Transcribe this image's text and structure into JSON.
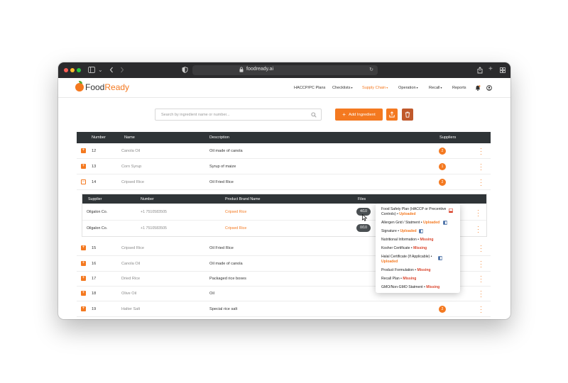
{
  "browser": {
    "url": "foodready.ai"
  },
  "app": {
    "logo_food": "Food",
    "logo_ready": "Ready"
  },
  "nav": [
    {
      "label": "HACCP/PC Plans",
      "caret": false,
      "active": false
    },
    {
      "label": "Checklists",
      "caret": true,
      "active": false
    },
    {
      "label": "Supply Chain",
      "caret": true,
      "active": true
    },
    {
      "label": "Operation",
      "caret": true,
      "active": false
    },
    {
      "label": "Recall",
      "caret": true,
      "active": false
    },
    {
      "label": "Reports",
      "caret": false,
      "active": false
    }
  ],
  "toolbar": {
    "search_placeholder": "Search by ingredient name or number...",
    "add_label": "Add Ingredient"
  },
  "table": {
    "headers": {
      "number": "Number",
      "name": "Name",
      "description": "Description",
      "suppliers": "Suppliers"
    },
    "rows_top": [
      {
        "num": "12",
        "name": "Canola Oil",
        "desc": "Oil made of canola",
        "suppliers": "2",
        "expanded": false
      },
      {
        "num": "13",
        "name": "Corn Syrup",
        "desc": "Syrup of maize",
        "suppliers": "1",
        "expanded": false
      },
      {
        "num": "14",
        "name": "Cripsed Rice",
        "desc": "Oil Fried Rice",
        "suppliers": "2",
        "expanded": true
      }
    ],
    "rows_bottom": [
      {
        "num": "15",
        "name": "Cripsed Rice",
        "desc": "Oil Fried Rice",
        "suppliers": ""
      },
      {
        "num": "16",
        "name": "Canola Oil",
        "desc": "Oil made of canola",
        "suppliers": ""
      },
      {
        "num": "17",
        "name": "Dried Rice",
        "desc": "Packaged rice boxes",
        "suppliers": ""
      },
      {
        "num": "18",
        "name": "Olive Oil",
        "desc": "Oil",
        "suppliers": ""
      },
      {
        "num": "19",
        "name": "Halter Salt",
        "desc": "Special rice salt",
        "suppliers": "2"
      }
    ]
  },
  "subtable": {
    "headers": {
      "supplier": "Supplier",
      "number": "Number",
      "brand": "Product Brand Name",
      "files": "Files"
    },
    "rows": [
      {
        "supplier": "Oilgalon Co.",
        "number": "+1 7510583505",
        "brand": "Cripsed Rice",
        "files": "4/10"
      },
      {
        "supplier": "Oilgalon Co.",
        "number": "+1 7510583505",
        "brand": "Cripsed Rice",
        "files": "0/10"
      }
    ]
  },
  "files_popover": {
    "items": [
      {
        "line1": "Food Safety Plan (HACCP or Precentive",
        "line2": "Controls)",
        "status": "Uploaded",
        "icon": "pdf-icon"
      },
      {
        "line1": "Allergen Grid / Statment",
        "line2": "",
        "status": "Uploaded",
        "icon": "word-icon"
      },
      {
        "line1": "Signature",
        "line2": "",
        "status": "Uploaded",
        "icon": "word-icon"
      },
      {
        "line1": "Nutritional Information",
        "line2": "",
        "status": "Missing",
        "icon": ""
      },
      {
        "line1": "Kosher Certificate",
        "line2": "",
        "status": "Missing",
        "icon": ""
      },
      {
        "line1": "Halal Certificate (If Applicable)",
        "line2": "",
        "status": "Uploaded",
        "icon": "word-icon"
      },
      {
        "line1": "Product Formulation",
        "line2": "",
        "status": "Missing",
        "icon": ""
      },
      {
        "line1": "Recall Plan",
        "line2": "",
        "status": "Missing",
        "icon": ""
      },
      {
        "line1": "GMO/Non-GMO Statment",
        "line2": "",
        "status": "Missing",
        "icon": ""
      }
    ]
  },
  "colors": {
    "accent": "#f47920",
    "header_bg": "#2f3437",
    "delete": "#c0592b",
    "missing": "#d9442c"
  }
}
